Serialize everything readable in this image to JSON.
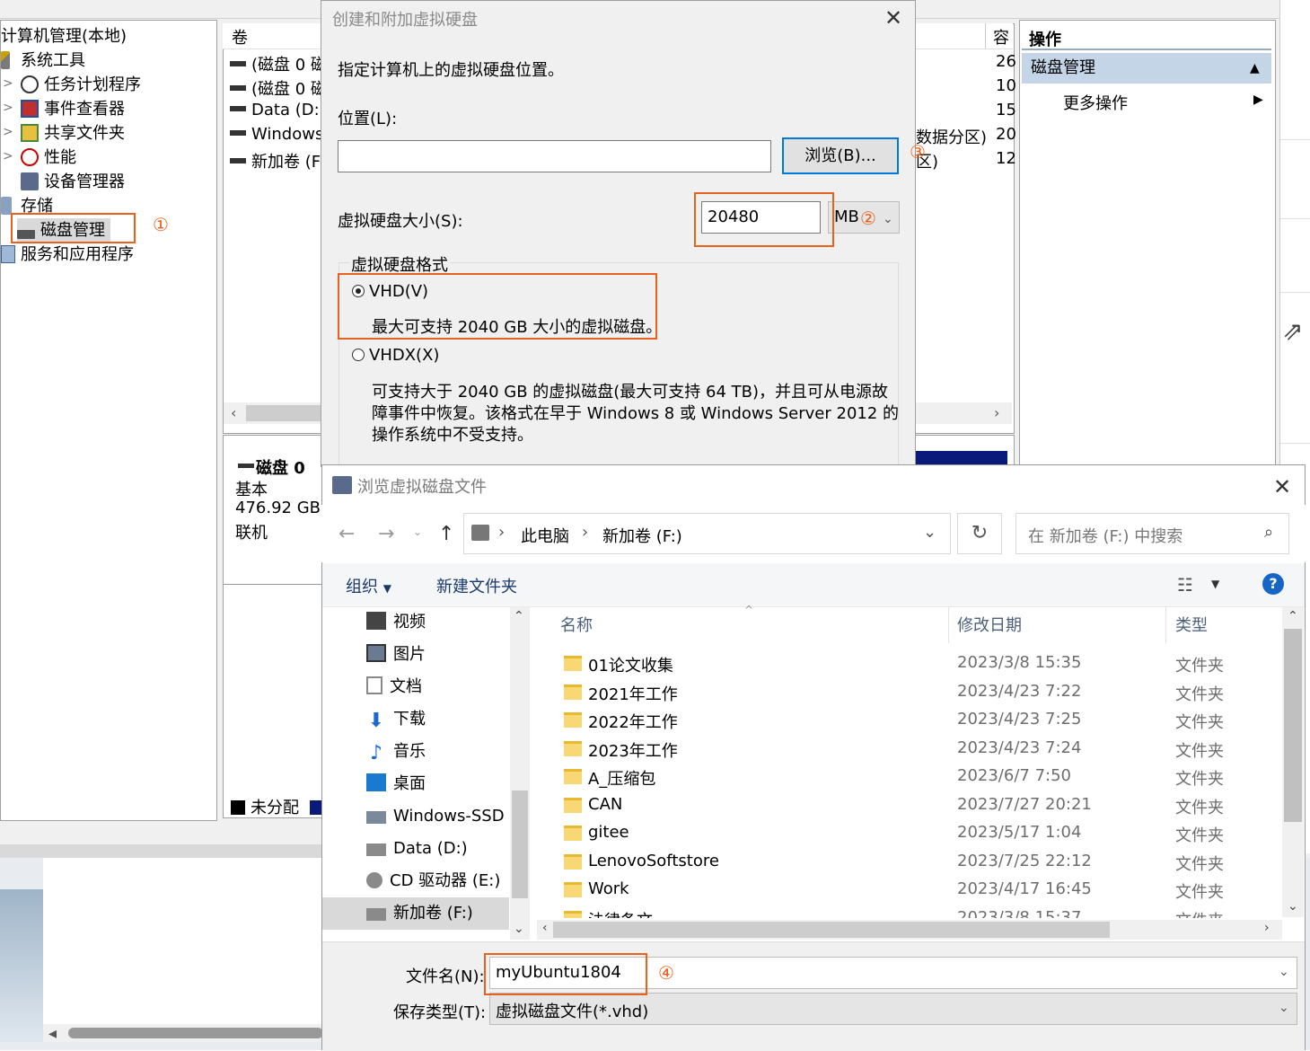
{
  "computer_management": {
    "tree": {
      "root": "计算机管理(本地)",
      "items": [
        "系统工具",
        "任务计划程序",
        "事件查看器",
        "共享文件夹",
        "性能",
        "设备管理器",
        "存储",
        "磁盘管理",
        "服务和应用程序"
      ]
    },
    "volumes": {
      "col_volume": "卷",
      "col_capacity": "容",
      "rows": [
        "(磁盘 0 磁",
        "(磁盘 0 磁",
        "Data (D:)",
        "Windows",
        "新加卷 (F:"
      ],
      "capacity_values": [
        "26",
        "10",
        "15",
        "20",
        "12"
      ],
      "partial_right": [
        "数据分区)",
        "区)"
      ]
    },
    "disk": {
      "name": "磁盘 0",
      "type": "基本",
      "size": "476.92 GB",
      "status": "联机",
      "legend_unallocated": "未分配"
    },
    "actions": {
      "header": "操作",
      "section": "磁盘管理",
      "more": "更多操作"
    }
  },
  "create_vhd_dialog": {
    "title": "创建和附加虚拟硬盘",
    "instruction": "指定计算机上的虚拟硬盘位置。",
    "location_label": "位置(L):",
    "location_value": "",
    "browse_button": "浏览(B)...",
    "size_label": "虚拟硬盘大小(S):",
    "size_value": "20480",
    "size_unit": "MB",
    "format_group": "虚拟硬盘格式",
    "vhd_option": "VHD(V)",
    "vhd_desc": "最大可支持 2040 GB 大小的虚拟磁盘。",
    "vhdx_option": "VHDX(X)",
    "vhdx_desc_1": "可支持大于 2040 GB 的虚拟磁盘(最大可支持 64 TB)，并且可从电源故",
    "vhdx_desc_2": "障事件中恢复。该格式在早于 Windows 8 或 Windows Server 2012 的",
    "vhdx_desc_3": "操作系统中不受支持。",
    "selected_format": "VHD"
  },
  "browse_dialog": {
    "title": "浏览虚拟磁盘文件",
    "breadcrumb": [
      "此电脑",
      "新加卷 (F:)"
    ],
    "search_placeholder": "在 新加卷 (F:) 中搜索",
    "organize": "组织",
    "new_folder": "新建文件夹",
    "nav_items": [
      "视频",
      "图片",
      "文档",
      "下载",
      "音乐",
      "桌面",
      "Windows-SSD (",
      "Data (D:)",
      "CD 驱动器 (E:)",
      "新加卷 (F:)"
    ],
    "columns": {
      "name": "名称",
      "modified": "修改日期",
      "type": "类型"
    },
    "files": [
      {
        "name": "01论文收集",
        "date": "2023/3/8 15:35",
        "type": "文件夹"
      },
      {
        "name": "2021年工作",
        "date": "2023/4/23 7:22",
        "type": "文件夹"
      },
      {
        "name": "2022年工作",
        "date": "2023/4/23 7:25",
        "type": "文件夹"
      },
      {
        "name": "2023年工作",
        "date": "2023/4/23 7:24",
        "type": "文件夹"
      },
      {
        "name": "A_压缩包",
        "date": "2023/6/7 7:50",
        "type": "文件夹"
      },
      {
        "name": "CAN",
        "date": "2023/7/27 20:21",
        "type": "文件夹"
      },
      {
        "name": "gitee",
        "date": "2023/5/17 1:04",
        "type": "文件夹"
      },
      {
        "name": "LenovoSoftstore",
        "date": "2023/7/25 22:12",
        "type": "文件夹"
      },
      {
        "name": "Work",
        "date": "2023/4/17 16:45",
        "type": "文件夹"
      },
      {
        "name": "法律条文",
        "date": "2023/3/8 15:37",
        "type": "文件夹"
      }
    ],
    "filename_label": "文件名(N):",
    "filename_value": "myUbuntu1804",
    "filetype_label": "保存类型(T):",
    "filetype_value": "虚拟磁盘文件(*.vhd)"
  },
  "annotations": [
    "①",
    "②",
    "③",
    "④"
  ],
  "colors": {
    "highlight": "#e8621e",
    "selection": "#c5d5e8",
    "accent": "#0078d7"
  }
}
